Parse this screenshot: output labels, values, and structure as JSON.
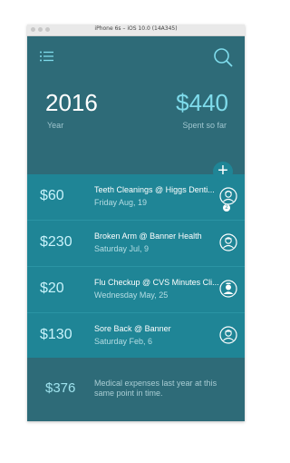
{
  "window": {
    "title": "iPhone 6s – iOS 10.0 (14A345)"
  },
  "header": {
    "menu_icon": "hamburger-menu-icon",
    "search_icon": "search-icon"
  },
  "summary": {
    "year_value": "2016",
    "year_label": "Year",
    "spent_value": "$440",
    "spent_label": "Spent so far"
  },
  "add_button_label": "+",
  "expenses": [
    {
      "amount": "$60",
      "title": "Teeth Cleanings @ Higgs Denti...",
      "date": "Friday Aug, 19",
      "icon": "dentist-avatar-icon",
      "badge": "2"
    },
    {
      "amount": "$230",
      "title": "Broken Arm @ Banner Health",
      "date": "Saturday Jul, 9",
      "icon": "doctor-avatar-icon",
      "badge": ""
    },
    {
      "amount": "$20",
      "title": "Flu Checkup @ CVS Minutes Cli...",
      "date": "Wednesday May, 25",
      "icon": "nurse-avatar-icon",
      "badge": ""
    },
    {
      "amount": "$130",
      "title": "Sore Back @ Banner",
      "date": "Saturday Feb, 6",
      "icon": "doctor-avatar-icon",
      "badge": ""
    }
  ],
  "footer": {
    "amount": "$376",
    "text": "Medical expenses last year at this same point in time."
  },
  "colors": {
    "background": "#2e6b78",
    "list_background": "#1f8596",
    "accent": "#7fdcec"
  }
}
